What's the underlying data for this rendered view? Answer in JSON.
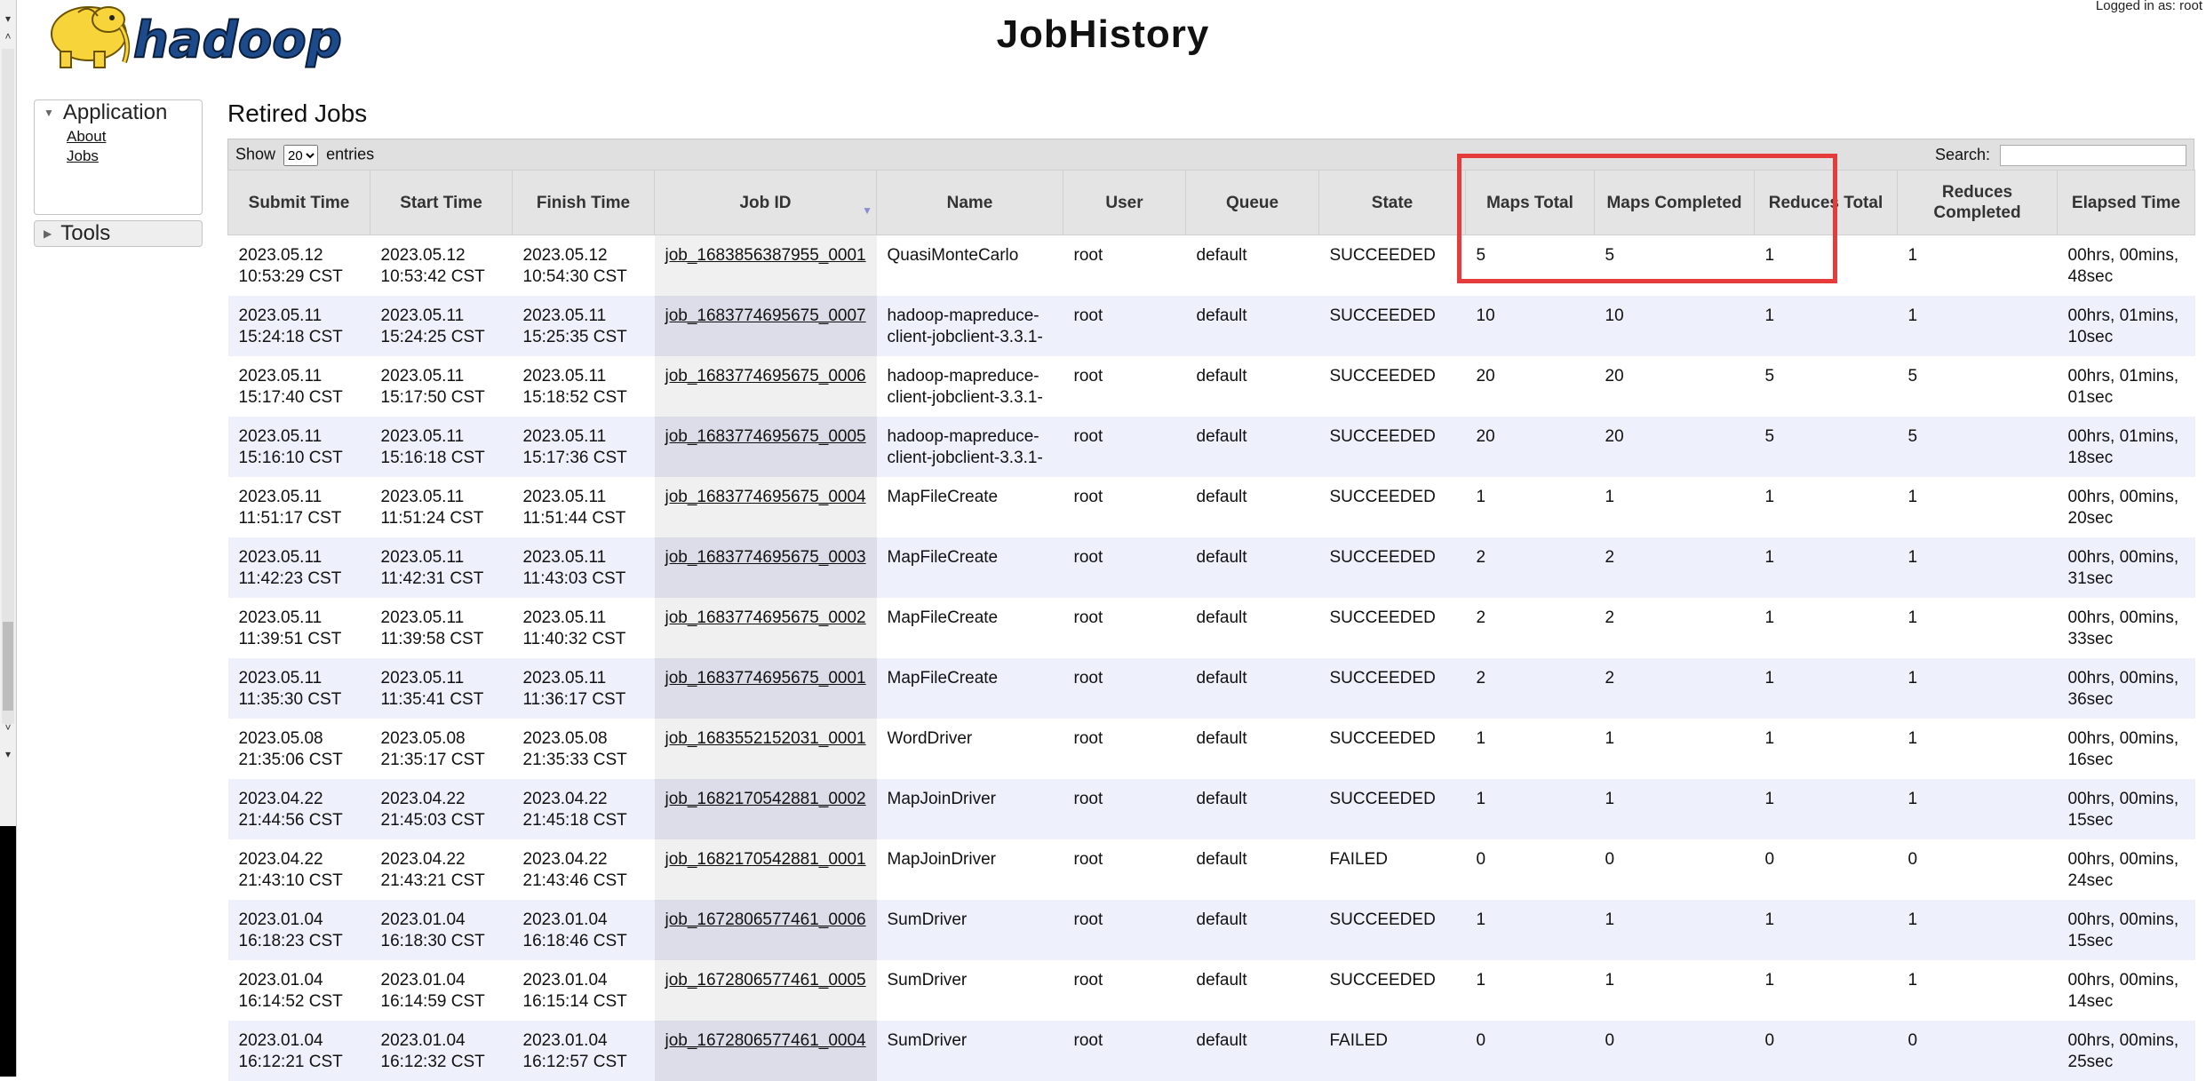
{
  "app": {
    "logo_text": "hadoop",
    "title": "JobHistory",
    "logged_in": "Logged in as: root"
  },
  "sidebar": {
    "application": {
      "label": "Application",
      "items": [
        "About",
        "Jobs"
      ]
    },
    "tools": {
      "label": "Tools"
    }
  },
  "page_title": "Retired Jobs",
  "controls": {
    "show_label": "Show",
    "entries_value": "20",
    "entries_label": "entries",
    "search_label": "Search:",
    "search_value": ""
  },
  "table": {
    "headers": [
      "Submit Time",
      "Start Time",
      "Finish Time",
      "Job ID",
      "Name",
      "User",
      "Queue",
      "State",
      "Maps Total",
      "Maps Completed",
      "Reduces Total",
      "Reduces Completed",
      "Elapsed Time"
    ],
    "rows": [
      [
        "2023.05.12 10:53:29 CST",
        "2023.05.12 10:53:42 CST",
        "2023.05.12 10:54:30 CST",
        "job_1683856387955_0001",
        "QuasiMonteCarlo",
        "root",
        "default",
        "SUCCEEDED",
        "5",
        "5",
        "1",
        "1",
        "00hrs, 00mins, 48sec"
      ],
      [
        "2023.05.11 15:24:18 CST",
        "2023.05.11 15:24:25 CST",
        "2023.05.11 15:25:35 CST",
        "job_1683774695675_0007",
        "hadoop-mapreduce-client-jobclient-3.3.1-",
        "root",
        "default",
        "SUCCEEDED",
        "10",
        "10",
        "1",
        "1",
        "00hrs, 01mins, 10sec"
      ],
      [
        "2023.05.11 15:17:40 CST",
        "2023.05.11 15:17:50 CST",
        "2023.05.11 15:18:52 CST",
        "job_1683774695675_0006",
        "hadoop-mapreduce-client-jobclient-3.3.1-",
        "root",
        "default",
        "SUCCEEDED",
        "20",
        "20",
        "5",
        "5",
        "00hrs, 01mins, 01sec"
      ],
      [
        "2023.05.11 15:16:10 CST",
        "2023.05.11 15:16:18 CST",
        "2023.05.11 15:17:36 CST",
        "job_1683774695675_0005",
        "hadoop-mapreduce-client-jobclient-3.3.1-",
        "root",
        "default",
        "SUCCEEDED",
        "20",
        "20",
        "5",
        "5",
        "00hrs, 01mins, 18sec"
      ],
      [
        "2023.05.11 11:51:17 CST",
        "2023.05.11 11:51:24 CST",
        "2023.05.11 11:51:44 CST",
        "job_1683774695675_0004",
        "MapFileCreate",
        "root",
        "default",
        "SUCCEEDED",
        "1",
        "1",
        "1",
        "1",
        "00hrs, 00mins, 20sec"
      ],
      [
        "2023.05.11 11:42:23 CST",
        "2023.05.11 11:42:31 CST",
        "2023.05.11 11:43:03 CST",
        "job_1683774695675_0003",
        "MapFileCreate",
        "root",
        "default",
        "SUCCEEDED",
        "2",
        "2",
        "1",
        "1",
        "00hrs, 00mins, 31sec"
      ],
      [
        "2023.05.11 11:39:51 CST",
        "2023.05.11 11:39:58 CST",
        "2023.05.11 11:40:32 CST",
        "job_1683774695675_0002",
        "MapFileCreate",
        "root",
        "default",
        "SUCCEEDED",
        "2",
        "2",
        "1",
        "1",
        "00hrs, 00mins, 33sec"
      ],
      [
        "2023.05.11 11:35:30 CST",
        "2023.05.11 11:35:41 CST",
        "2023.05.11 11:36:17 CST",
        "job_1683774695675_0001",
        "MapFileCreate",
        "root",
        "default",
        "SUCCEEDED",
        "2",
        "2",
        "1",
        "1",
        "00hrs, 00mins, 36sec"
      ],
      [
        "2023.05.08 21:35:06 CST",
        "2023.05.08 21:35:17 CST",
        "2023.05.08 21:35:33 CST",
        "job_1683552152031_0001",
        "WordDriver",
        "root",
        "default",
        "SUCCEEDED",
        "1",
        "1",
        "1",
        "1",
        "00hrs, 00mins, 16sec"
      ],
      [
        "2023.04.22 21:44:56 CST",
        "2023.04.22 21:45:03 CST",
        "2023.04.22 21:45:18 CST",
        "job_1682170542881_0002",
        "MapJoinDriver",
        "root",
        "default",
        "SUCCEEDED",
        "1",
        "1",
        "1",
        "1",
        "00hrs, 00mins, 15sec"
      ],
      [
        "2023.04.22 21:43:10 CST",
        "2023.04.22 21:43:21 CST",
        "2023.04.22 21:43:46 CST",
        "job_1682170542881_0001",
        "MapJoinDriver",
        "root",
        "default",
        "FAILED",
        "0",
        "0",
        "0",
        "0",
        "00hrs, 00mins, 24sec"
      ],
      [
        "2023.01.04 16:18:23 CST",
        "2023.01.04 16:18:30 CST",
        "2023.01.04 16:18:46 CST",
        "job_1672806577461_0006",
        "SumDriver",
        "root",
        "default",
        "SUCCEEDED",
        "1",
        "1",
        "1",
        "1",
        "00hrs, 00mins, 15sec"
      ],
      [
        "2023.01.04 16:14:52 CST",
        "2023.01.04 16:14:59 CST",
        "2023.01.04 16:15:14 CST",
        "job_1672806577461_0005",
        "SumDriver",
        "root",
        "default",
        "SUCCEEDED",
        "1",
        "1",
        "1",
        "1",
        "00hrs, 00mins, 14sec"
      ],
      [
        "2023.01.04 16:12:21 CST",
        "2023.01.04 16:12:32 CST",
        "2023.01.04 16:12:57 CST",
        "job_1672806577461_0004",
        "SumDriver",
        "root",
        "default",
        "FAILED",
        "0",
        "0",
        "0",
        "0",
        "00hrs, 00mins, 25sec"
      ]
    ]
  },
  "colors": {
    "highlight": "#e53b3b",
    "row_even": "#eef0fb",
    "header_bg": "#e4e4e4",
    "logo_yellow": "#f6d43a",
    "logo_blue": "#1c4a8a"
  }
}
